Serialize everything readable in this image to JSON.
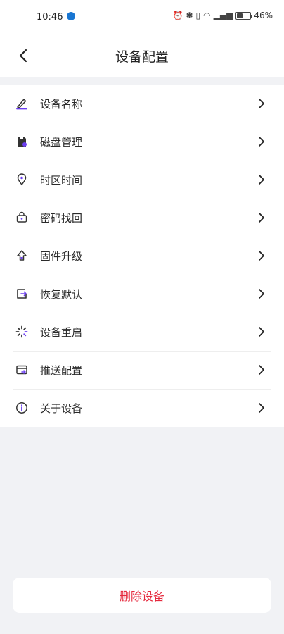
{
  "status_bar": {
    "time": "10:46",
    "battery_percent": "46%",
    "battery_level": 0.46
  },
  "header": {
    "title": "设备配置"
  },
  "menu": {
    "items": [
      {
        "label": "设备名称",
        "icon": "edit-pen-icon"
      },
      {
        "label": "磁盘管理",
        "icon": "disk-icon"
      },
      {
        "label": "时区时间",
        "icon": "location-pin-icon"
      },
      {
        "label": "密码找回",
        "icon": "password-recovery-icon"
      },
      {
        "label": "固件升级",
        "icon": "upgrade-arrow-icon"
      },
      {
        "label": "恢复默认",
        "icon": "restore-icon"
      },
      {
        "label": "设备重启",
        "icon": "restart-spinner-icon"
      },
      {
        "label": "推送配置",
        "icon": "push-card-icon"
      },
      {
        "label": "关于设备",
        "icon": "info-icon"
      }
    ]
  },
  "footer": {
    "delete_label": "删除设备"
  },
  "colors": {
    "accent": "#6a3df0",
    "danger": "#e5293d",
    "background": "#f1f2f5"
  }
}
